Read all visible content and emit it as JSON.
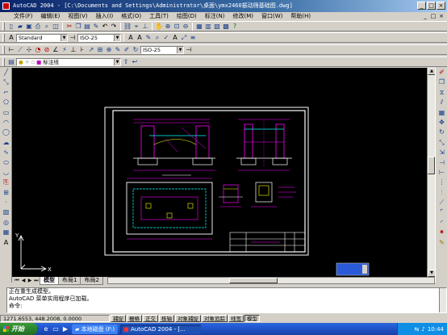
{
  "window": {
    "title": "AutoCAD 2004 - [C:\\Documents and Settings\\Administrator\\桌面\\ymx2460振动筛基础图.dwg]",
    "controls": [
      "_",
      "□",
      "×"
    ]
  },
  "menu": {
    "items": [
      "文件(F)",
      "编辑(E)",
      "视图(V)",
      "插入(I)",
      "格式(O)",
      "工具(T)",
      "绘图(D)",
      "标注(N)",
      "修改(M)",
      "窗口(W)",
      "帮助(H)"
    ],
    "doc_controls": [
      "_",
      "□",
      "×"
    ]
  },
  "styles_toolbar": {
    "text_style": "Standard",
    "dim_style": "ISO-25"
  },
  "dim_toolbar": {
    "dim_style": "ISO-25"
  },
  "layers_toolbar": {
    "layer_name": "标注线"
  },
  "tabs": [
    "模型",
    "布局1",
    "布局2"
  ],
  "command": {
    "lines": [
      "正在重生成模型。",
      "AutoCAD 菜单实用程序已加载。",
      "命令:"
    ]
  },
  "status": {
    "coords": "1271.6553, 448.2008, 0.0000",
    "buttons": [
      "捕捉",
      "栅格",
      "正交",
      "极轴",
      "对象捕捉",
      "对象追踪",
      "线宽",
      "模型"
    ],
    "active": [
      false,
      false,
      false,
      false,
      false,
      false,
      false,
      true
    ]
  },
  "taskbar": {
    "start": "开始",
    "tasks": [
      "本地磁盘 (F:)",
      "AutoCAD 2004 - [..."
    ],
    "clock": "10:44"
  },
  "colors": {
    "drawing_bg": "#000000",
    "frame": "#ffffff",
    "dimension": "#ff00ff",
    "foundation": "#00ffff",
    "rebar": "#ffff00",
    "accent": "#2a5ad7"
  }
}
